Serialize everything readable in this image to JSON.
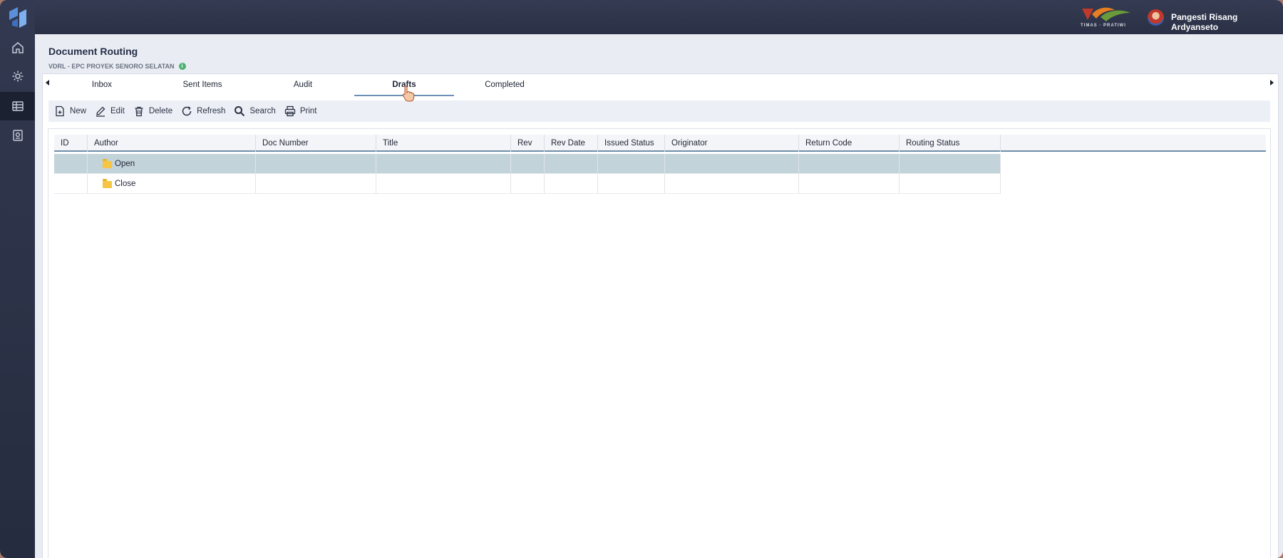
{
  "user": {
    "name": "Pangesti Risang Ardyanseto"
  },
  "brand": {
    "text": "TIMAS · PRATIWI"
  },
  "page": {
    "title": "Document Routing",
    "subtitle": "VDRL - EPC PROYEK SENORO SELATAN"
  },
  "sidebar": {
    "items": [
      {
        "icon": "home-icon"
      },
      {
        "icon": "gear-icon"
      },
      {
        "icon": "grid-icon",
        "active": true
      },
      {
        "icon": "document-icon"
      }
    ]
  },
  "tabs": [
    {
      "label": "Inbox"
    },
    {
      "label": "Sent Items"
    },
    {
      "label": "Audit"
    },
    {
      "label": "Drafts",
      "active": true
    },
    {
      "label": "Completed"
    }
  ],
  "toolbar": {
    "new": "New",
    "edit": "Edit",
    "delete": "Delete",
    "refresh": "Refresh",
    "search": "Search",
    "print": "Print"
  },
  "grid": {
    "columns": [
      "ID",
      "Author",
      "Doc Number",
      "Title",
      "Rev",
      "Rev Date",
      "Issued Status",
      "Originator",
      "Return Code",
      "Routing Status"
    ],
    "rows": [
      {
        "label": "Open",
        "selected": true
      },
      {
        "label": "Close",
        "selected": false
      }
    ]
  },
  "colors": {
    "topbar": "#2f354b",
    "selected_row": "#c3d3da",
    "tab_underline": "#6b8fb5"
  }
}
